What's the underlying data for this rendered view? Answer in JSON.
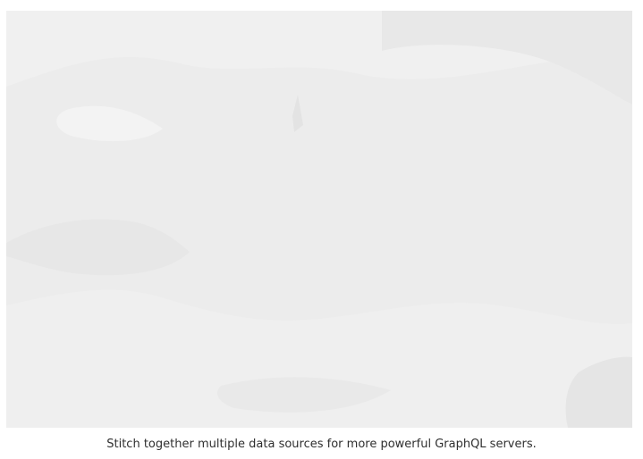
{
  "figure": {
    "caption": "Stitch together multiple data sources for more powerful GraphQL servers."
  }
}
